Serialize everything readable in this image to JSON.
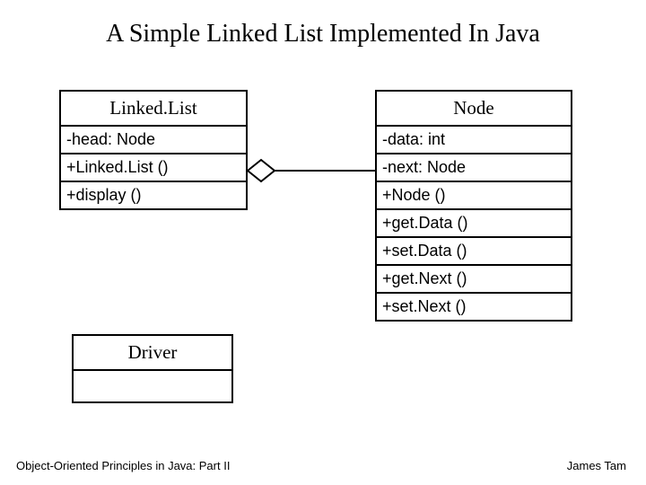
{
  "title": "A Simple Linked List Implemented In Java",
  "classes": {
    "linkedlist": {
      "name": "Linked.List",
      "rows": [
        "-head: Node",
        "+Linked.List ()",
        "+display ()"
      ]
    },
    "node": {
      "name": "Node",
      "rows": [
        "-data: int",
        "-next: Node",
        "+Node ()",
        "+get.Data ()",
        "+set.Data ()",
        "+get.Next ()",
        "+set.Next ()"
      ]
    },
    "driver": {
      "name": "Driver",
      "rows": []
    }
  },
  "footer": {
    "left": "Object-Oriented Principles in Java: Part II",
    "right": "James Tam"
  },
  "connector": {
    "type": "aggregation",
    "from": "linkedlist",
    "to": "node"
  }
}
